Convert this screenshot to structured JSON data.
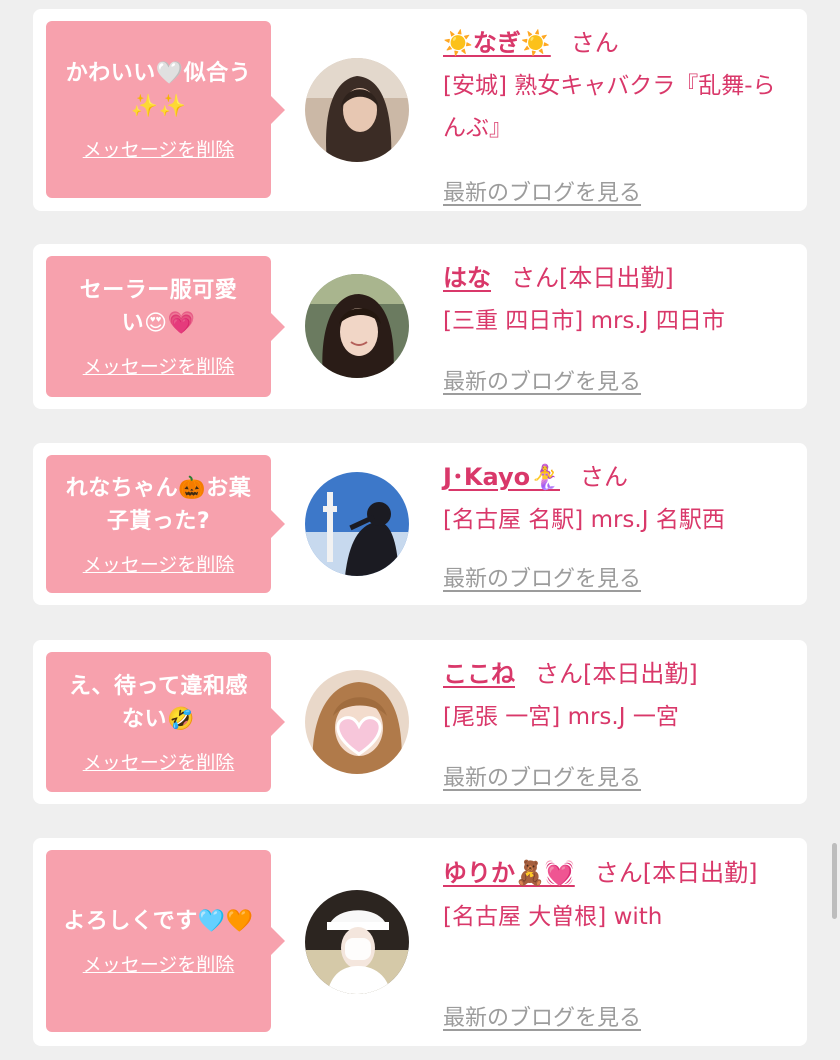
{
  "cards": [
    {
      "message": "かわいい🤍似合う✨✨",
      "delete_label": "メッセージを削除",
      "name": "☀️なぎ☀️",
      "honorific": "さん",
      "shop": "[安城] 熟女キャバクラ『乱舞-らんぶ』",
      "blog_link": "最新のブログを見る",
      "avatar_icon": "long-hair-woman-avatar"
    },
    {
      "message": "セーラー服可愛い😍💗",
      "delete_label": "メッセージを削除",
      "name": "はな",
      "honorific": "さん[本日出勤]",
      "shop": "[三重 四日市] mrs.J 四日市",
      "blog_link": "最新のブログを見る",
      "avatar_icon": "smiling-woman-avatar"
    },
    {
      "message": "れなちゃん🎃お菓子貰った?",
      "delete_label": "メッセージを削除",
      "name": "J･Kayo🧜‍♀️",
      "honorific": "さん",
      "shop": "[名古屋 名駅] mrs.J 名駅西",
      "blog_link": "最新のブログを見る",
      "avatar_icon": "tower-silhouette-avatar"
    },
    {
      "message": "え、待って違和感ない🤣",
      "delete_label": "メッセージを削除",
      "name": "ここね",
      "honorific": "さん[本日出勤]",
      "shop": "[尾張 一宮] mrs.J 一宮",
      "blog_link": "最新のブログを見る",
      "avatar_icon": "heart-sticker-avatar"
    },
    {
      "message": "よろしくです🩵🧡",
      "delete_label": "メッセージを削除",
      "name": "ゆりか🧸💓",
      "honorific": "さん[本日出勤]",
      "shop": "[名古屋 大曽根] with",
      "blog_link": "最新のブログを見る",
      "avatar_icon": "nurse-cap-avatar"
    }
  ],
  "colors": {
    "accent": "#d9386a",
    "bubble": "#f7a1ad",
    "background": "#efefef",
    "link_gray": "#9c9c9c"
  }
}
